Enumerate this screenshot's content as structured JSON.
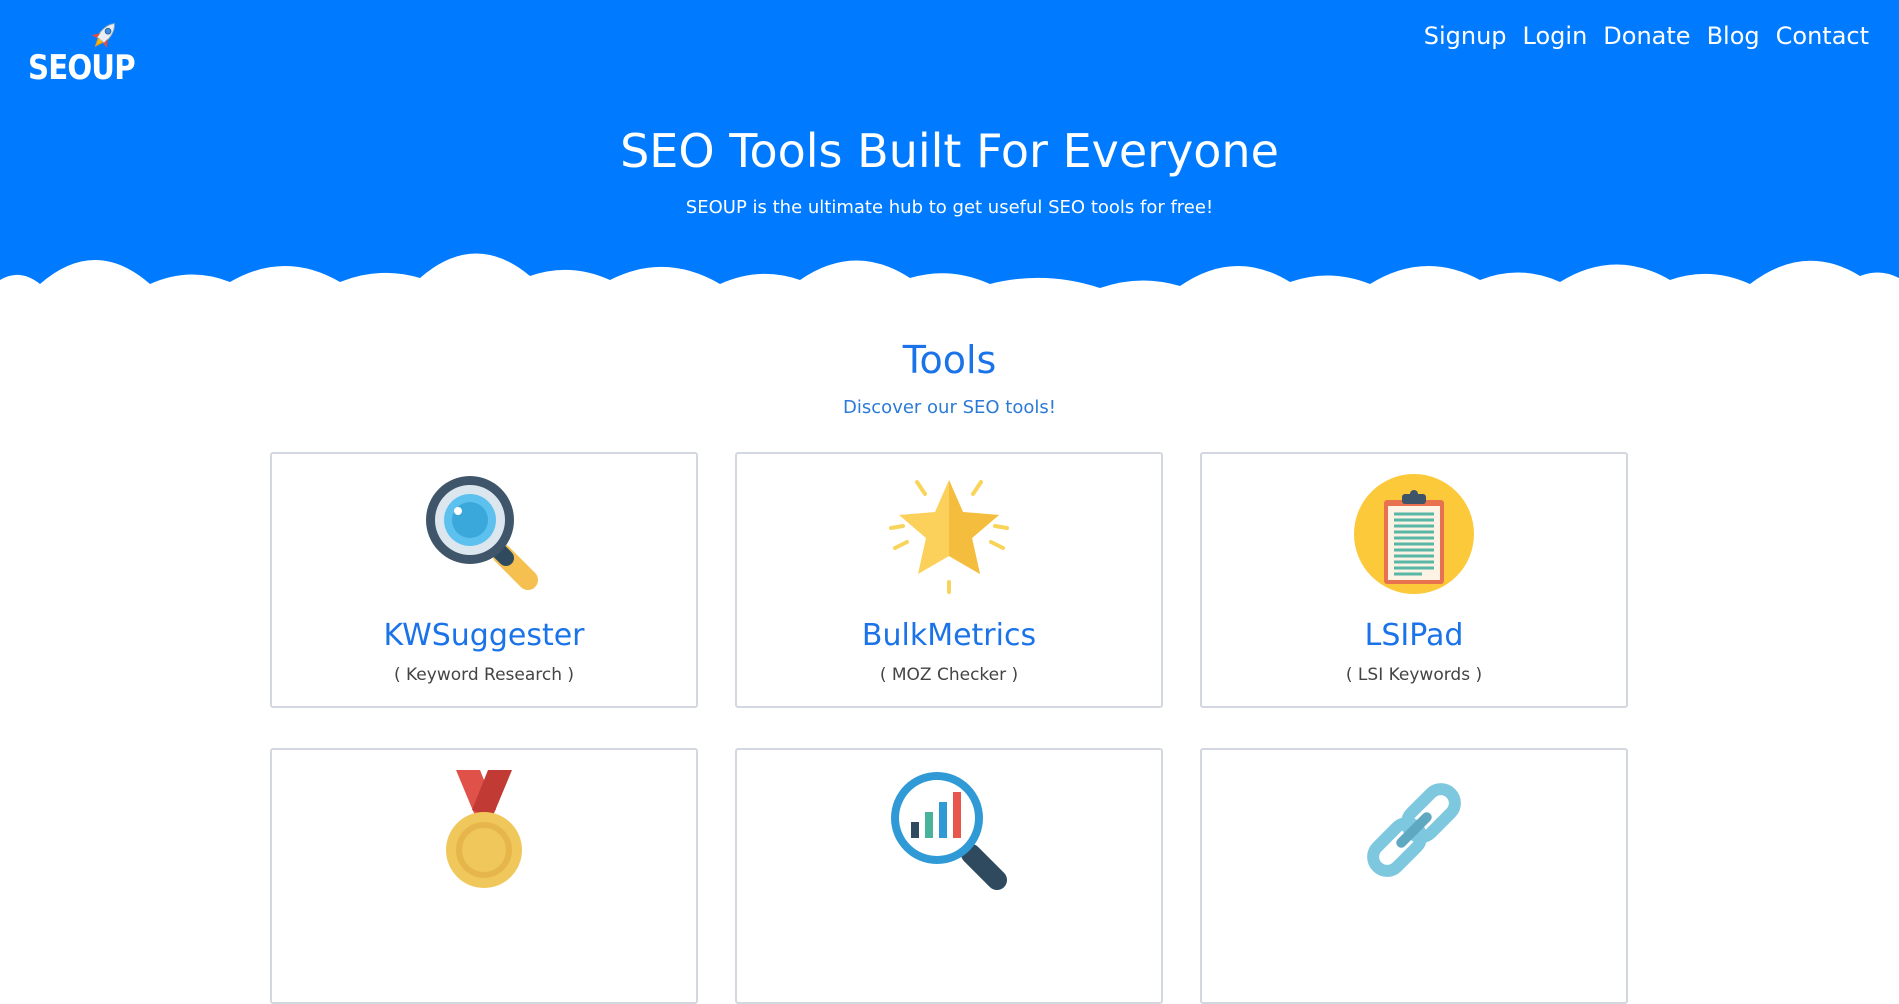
{
  "brand": {
    "logo_text": "SEOUP"
  },
  "nav": {
    "items": [
      "Signup",
      "Login",
      "Donate",
      "Blog",
      "Contact"
    ]
  },
  "hero": {
    "title": "SEO Tools Built For Everyone",
    "subtitle": "SEOUP is the ultimate hub to get useful SEO tools for free!"
  },
  "tools_section": {
    "title": "Tools",
    "subtitle": "Discover our SEO tools!",
    "cards": [
      {
        "name": "KWSuggester",
        "desc": "( Keyword Research )",
        "icon": "magnifier-icon"
      },
      {
        "name": "BulkMetrics",
        "desc": "( MOZ Checker )",
        "icon": "star-icon"
      },
      {
        "name": "LSIPad",
        "desc": "( LSI Keywords )",
        "icon": "clipboard-icon"
      },
      {
        "name": "",
        "desc": "",
        "icon": "medal-icon"
      },
      {
        "name": "",
        "desc": "",
        "icon": "analytics-magnifier-icon"
      },
      {
        "name": "",
        "desc": "",
        "icon": "chain-link-icon"
      }
    ]
  },
  "colors": {
    "hero_bg": "#007bff",
    "accent": "#1a73e8",
    "card_border": "#d3d7df"
  }
}
